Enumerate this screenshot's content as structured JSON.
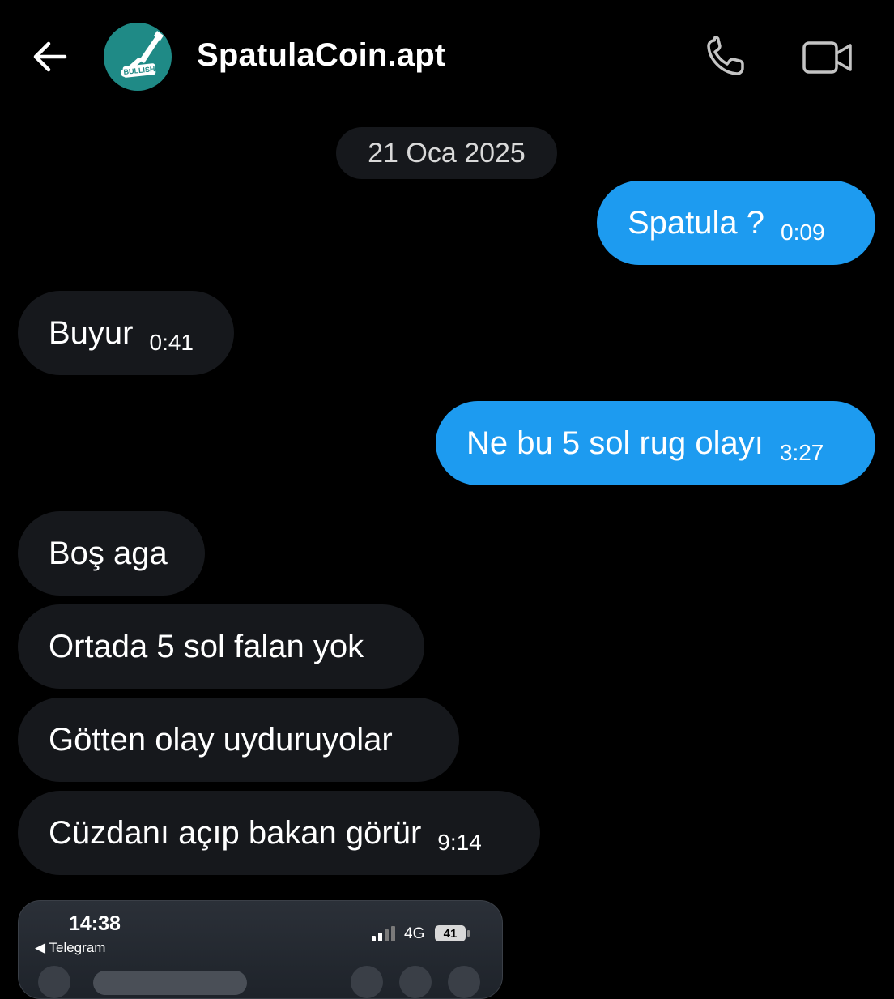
{
  "header": {
    "title": "SpatulaCoin.apt",
    "avatar_text": "BULLISH",
    "avatar_color": "#1f8a86"
  },
  "colors": {
    "background": "#000000",
    "sent_bubble": "#1d9bf0",
    "received_bubble": "#16181c"
  },
  "date_separator": "21 Oca 2025",
  "messages": [
    {
      "direction": "sent",
      "text": "Spatula ?",
      "time": "0:09"
    },
    {
      "direction": "received",
      "text": "Buyur",
      "time": "0:41"
    },
    {
      "direction": "sent",
      "text": "Ne bu 5 sol rug olayı",
      "time": "3:27"
    },
    {
      "direction": "received",
      "text": "Boş aga",
      "time": ""
    },
    {
      "direction": "received",
      "text": "Ortada 5 sol falan yok",
      "time": ""
    },
    {
      "direction": "received",
      "text": "Götten olay uyduruyolar",
      "time": ""
    },
    {
      "direction": "received",
      "text": "Cüzdanı açıp bakan görür",
      "time": "9:14"
    }
  ],
  "attachment_preview": {
    "status_time": "14:38",
    "back_app": "◀ Telegram",
    "network": "4G",
    "battery": "41"
  }
}
